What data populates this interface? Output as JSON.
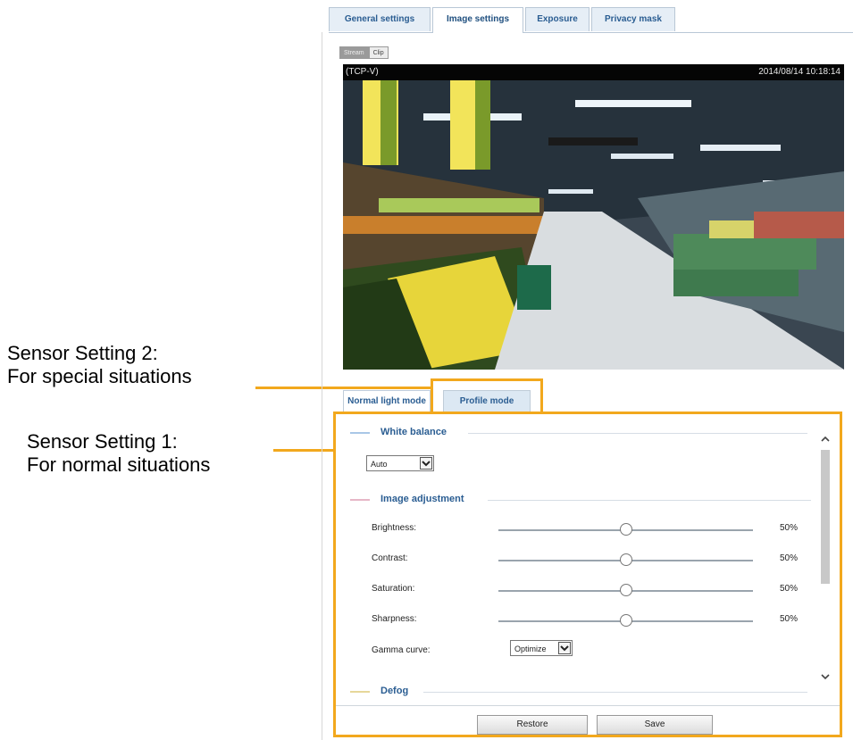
{
  "annotations": {
    "sensor2_line1": "Sensor Setting 2:",
    "sensor2_line2": "For special situations",
    "sensor1_line1": "Sensor Setting 1:",
    "sensor1_line2": "For normal situations",
    "highlight_color": "#f2a81d"
  },
  "tabs": [
    {
      "label": "General settings"
    },
    {
      "label": "Image settings",
      "active": true
    },
    {
      "label": "Exposure"
    },
    {
      "label": "Privacy mask"
    }
  ],
  "stream_toggle": {
    "left": "Stream",
    "right": "Clip"
  },
  "video": {
    "caption": "(TCP-V)",
    "timestamp": "2014/08/14 10:18:14"
  },
  "sub_tabs": {
    "normal": "Normal light mode",
    "profile": "Profile mode"
  },
  "white_balance": {
    "legend": "White balance",
    "value": "Auto"
  },
  "image_adjustment": {
    "legend": "Image adjustment",
    "sliders": [
      {
        "label": "Brightness:",
        "value": "50%",
        "level": 0.5
      },
      {
        "label": "Contrast:",
        "value": "50%",
        "level": 0.5
      },
      {
        "label": "Saturation:",
        "value": "50%",
        "level": 0.5
      },
      {
        "label": "Sharpness:",
        "value": "50%",
        "level": 0.5
      }
    ],
    "gamma_label": "Gamma curve:",
    "gamma_value": "Optimize"
  },
  "defog": {
    "legend": "Defog"
  },
  "buttons": {
    "restore": "Restore",
    "save": "Save"
  },
  "colors": {
    "tab_text": "#2a5d92",
    "legend_accent": "#a9c7e6"
  }
}
